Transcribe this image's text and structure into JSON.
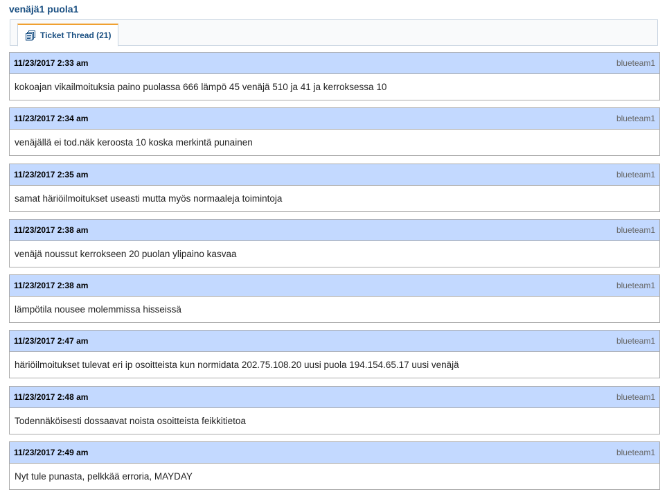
{
  "ticket": {
    "title": "venäjä1 puola1"
  },
  "tabs": [
    {
      "label": "Ticket Thread (21)",
      "icon": "thread-icon",
      "active": true
    }
  ],
  "colors": {
    "title": "#184e81",
    "header_bg": "#c3d9ff",
    "tab_accent": "#f0a030",
    "poster_text": "#666666"
  },
  "thread": [
    {
      "date": "11/23/2017 2:33 am",
      "poster": "blueteam1",
      "body": "kokoajan vikailmoituksia paino puolassa 666 lämpö 45 venäjä 510 ja 41 ja kerroksessa 10"
    },
    {
      "date": "11/23/2017 2:34 am",
      "poster": "blueteam1",
      "body": "venäjällä ei tod.näk keroosta 10 koska merkintä punainen"
    },
    {
      "date": "11/23/2017 2:35 am",
      "poster": "blueteam1",
      "body": "samat häriöilmoitukset useasti mutta myös normaaleja toimintoja"
    },
    {
      "date": "11/23/2017 2:38 am",
      "poster": "blueteam1",
      "body": "venäjä noussut kerrokseen 20 puolan ylipaino kasvaa"
    },
    {
      "date": "11/23/2017 2:38 am",
      "poster": "blueteam1",
      "body": "lämpötila nousee molemmissa hisseissä"
    },
    {
      "date": "11/23/2017 2:47 am",
      "poster": "blueteam1",
      "body": "häriöilmoitukset tulevat eri ip osoitteista kun normidata 202.75.108.20 uusi puola 194.154.65.17 uusi venäjä"
    },
    {
      "date": "11/23/2017 2:48 am",
      "poster": "blueteam1",
      "body": "Todennäköisesti dossaavat noista osoitteista feikkitietoa"
    },
    {
      "date": "11/23/2017 2:49 am",
      "poster": "blueteam1",
      "body": "Nyt tule punasta, pelkkää erroria, MAYDAY"
    }
  ]
}
